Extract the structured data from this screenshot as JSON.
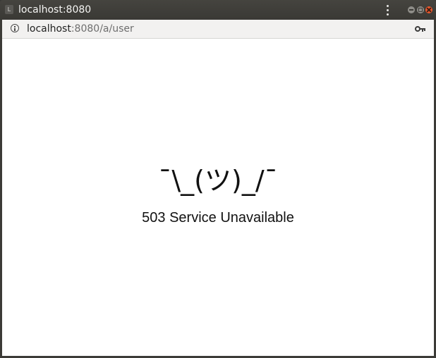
{
  "window": {
    "title": "localhost:8080",
    "favicon_glyph": "L"
  },
  "address_bar": {
    "host": "localhost",
    "path": ":8080/a/user",
    "info_icon": "info-icon",
    "key_icon": "key-icon"
  },
  "page": {
    "shrug": "¯\\_(ツ)_/¯",
    "message": "503 Service Unavailable"
  },
  "colors": {
    "titlebar": "#3c3b37",
    "close_button": "#e9592e",
    "page_background": "#ffffff",
    "text": "#111111"
  }
}
